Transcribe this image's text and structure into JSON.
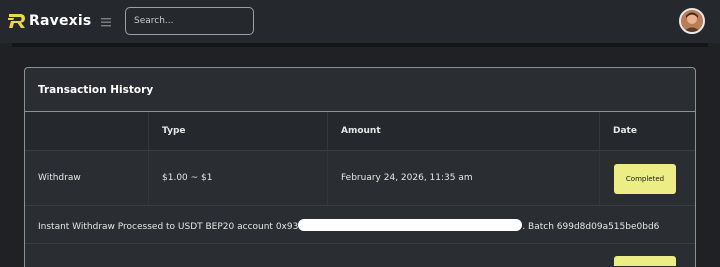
{
  "brand": {
    "name": "Ravexis",
    "accent": "#e8d84a"
  },
  "search": {
    "placeholder": "Search..."
  },
  "card": {
    "title": "Transaction History"
  },
  "table": {
    "headers": [
      "",
      "Type",
      "Amount",
      "Date"
    ],
    "rows": [
      {
        "type": "Withdraw",
        "amount": "$1.00 ~ $1",
        "date": "February 24, 2026, 11:35 am",
        "status": "Completed"
      }
    ],
    "detail": {
      "prefix": "Instant Withdraw Processed to USDT BEP20 account 0x93",
      "suffix": ". Batch 699d8d09a515be0bd6"
    }
  },
  "colors": {
    "status_completed": "#eded85",
    "background": "#1f2124",
    "topbar": "#25282c"
  },
  "icons": [
    "ravexis-logo-icon",
    "hamburger-menu-icon",
    "user-avatar-icon"
  ]
}
